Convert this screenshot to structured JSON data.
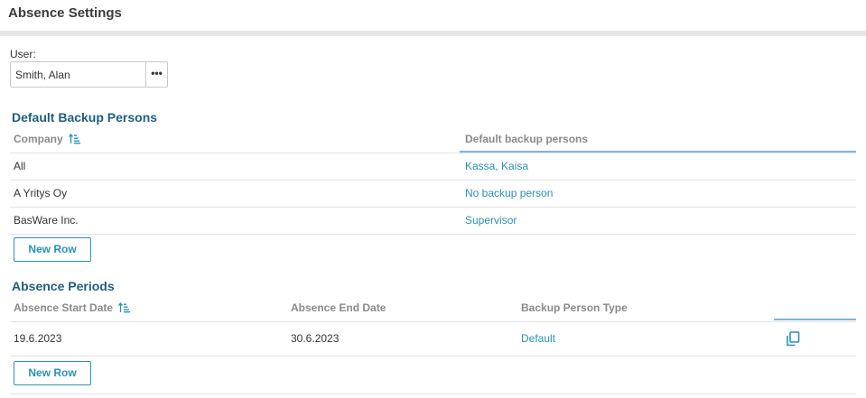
{
  "header": {
    "title": "Absence Settings"
  },
  "user": {
    "label": "User:",
    "value": "Smith, Alan",
    "more_label": "•••"
  },
  "backup": {
    "title": "Default Backup Persons",
    "columns": {
      "company": "Company",
      "persons": "Default backup persons"
    },
    "rows": [
      {
        "company": "All",
        "person": "Kassa, Kaisa"
      },
      {
        "company": "A Yritys Oy",
        "person": "No backup person"
      },
      {
        "company": "BasWare Inc.",
        "person": "Supervisor"
      }
    ],
    "new_row_label": "New Row"
  },
  "periods": {
    "title": "Absence Periods",
    "columns": {
      "start": "Absence Start Date",
      "end": "Absence End Date",
      "type": "Backup Person Type"
    },
    "rows": [
      {
        "start": "19.6.2023",
        "end": "30.6.2023",
        "type": "Default"
      }
    ],
    "new_row_label": "New Row"
  },
  "colors": {
    "accent": "#2a91b8",
    "section_title": "#1f5f7f",
    "column_header": "#8a8a8a"
  },
  "icons": {
    "sort": "sort-ascending-icon",
    "copy": "copy-icon"
  }
}
